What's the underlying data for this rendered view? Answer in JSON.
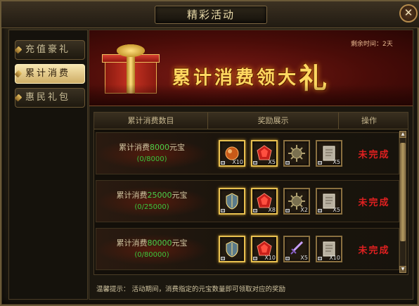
{
  "window": {
    "title": "精彩活动",
    "close_label": "✕"
  },
  "sidebar": {
    "items": [
      {
        "label": "充值豪礼",
        "active": false
      },
      {
        "label": "累计消费",
        "active": true
      },
      {
        "label": "惠民礼包",
        "active": false
      }
    ]
  },
  "banner": {
    "title_prefix": "累计消费领大",
    "title_big": "礼",
    "remaining_time": "剩余时间：2天"
  },
  "table": {
    "headers": [
      "累计消费数目",
      "奖励展示",
      "操作"
    ],
    "rows": [
      {
        "req_prefix": "累计消费",
        "req_amount": "8000",
        "req_suffix": "元宝",
        "progress": "(0/8000)",
        "status": "未完成",
        "items": [
          {
            "icon": "orb-icon",
            "count": "X10",
            "gold": true
          },
          {
            "icon": "red-gem-icon",
            "count": "X5",
            "gold": true
          },
          {
            "icon": "spiked-ball-icon",
            "count": "",
            "gold": false
          },
          {
            "icon": "scroll-icon",
            "count": "X5",
            "gold": false
          }
        ]
      },
      {
        "req_prefix": "累计消费",
        "req_amount": "25000",
        "req_suffix": "元宝",
        "progress": "(0/25000)",
        "status": "未完成",
        "items": [
          {
            "icon": "armor-icon",
            "count": "",
            "gold": true
          },
          {
            "icon": "red-gem-icon",
            "count": "X8",
            "gold": true
          },
          {
            "icon": "spiked-ball-icon",
            "count": "X2",
            "gold": false
          },
          {
            "icon": "scroll-icon",
            "count": "X5",
            "gold": false
          }
        ]
      },
      {
        "req_prefix": "累计消费",
        "req_amount": "80000",
        "req_suffix": "元宝",
        "progress": "(0/80000)",
        "status": "未完成",
        "items": [
          {
            "icon": "armor-icon",
            "count": "",
            "gold": true
          },
          {
            "icon": "red-gem-icon",
            "count": "X10",
            "gold": true
          },
          {
            "icon": "sword-icon",
            "count": "X5",
            "gold": false
          },
          {
            "icon": "scroll-icon",
            "count": "X10",
            "gold": false
          }
        ]
      }
    ]
  },
  "footer": {
    "tip": "温馨提示：  活动期间，消费指定的元宝数量即可领取对应的奖励"
  },
  "colors": {
    "gold_accent": "#e8c050",
    "status_red": "#e02020",
    "progress_green": "#3cc43c"
  }
}
